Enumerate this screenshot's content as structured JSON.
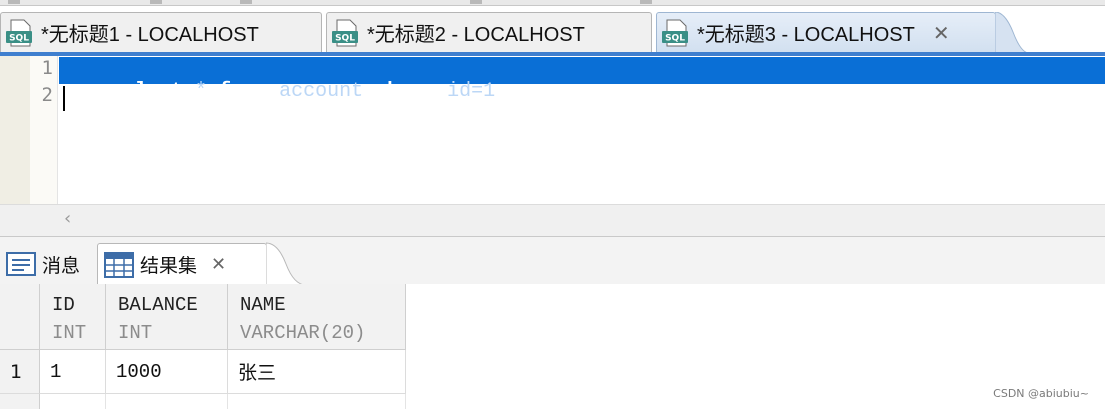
{
  "editor_tabs": [
    {
      "label": "*无标题1 - LOCALHOST",
      "active": false
    },
    {
      "label": "*无标题2 - LOCALHOST",
      "active": false
    },
    {
      "label": "*无标题3 - LOCALHOST",
      "active": true
    }
  ],
  "sql_icon_text": "SQL",
  "close_glyph": "✕",
  "editor": {
    "line_numbers": [
      "1",
      "2"
    ],
    "line1": {
      "kw_select": "select",
      "star": " * ",
      "kw_from": "from",
      "table": " account ",
      "kw_where": "where",
      "cond": " id=1"
    }
  },
  "scroll_left_glyph": "‹",
  "result_tabs": [
    {
      "label": "消息",
      "active": false
    },
    {
      "label": "结果集",
      "active": true
    }
  ],
  "result_close_glyph": "✕",
  "grid": {
    "columns": [
      {
        "name": "ID",
        "type": "INT"
      },
      {
        "name": "BALANCE",
        "type": "INT"
      },
      {
        "name": "NAME",
        "type": "VARCHAR(20)"
      }
    ],
    "rows": [
      {
        "num": "1",
        "cells": [
          "1",
          "1000",
          "张三"
        ]
      }
    ]
  },
  "watermark": "CSDN @abiubiu~",
  "colors": {
    "selection": "#0a6fd6",
    "divider": "#3f7fcf",
    "sql_icon": "#3a8f86"
  }
}
